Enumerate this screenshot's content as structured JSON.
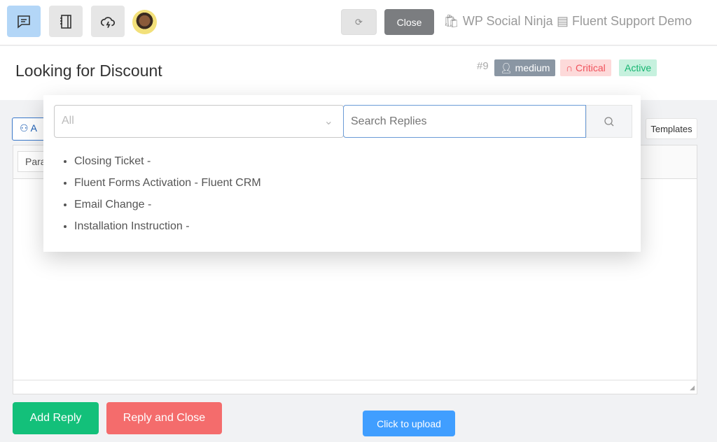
{
  "topbar": {
    "close_label": "Close",
    "crumbs": [
      "WP Social Ninja",
      "Fluent Support Demo"
    ]
  },
  "ticket": {
    "title": "Looking for Discount",
    "number": "#9",
    "badges": {
      "priority_label": "medium",
      "severity_label": "Critical",
      "status_label": "Active"
    }
  },
  "editor": {
    "ai_label": "A",
    "format_label": "Para",
    "templates_label": "Templates"
  },
  "saved_replies": {
    "category_value": "All",
    "search_placeholder": "Search Replies",
    "items": [
      "Closing Ticket -",
      "Fluent Forms Activation - Fluent CRM",
      "Email Change -",
      "Installation Instruction -"
    ]
  },
  "actions": {
    "add_reply": "Add Reply",
    "reply_close": "Reply and Close",
    "upload": "Click to upload"
  },
  "colors": {
    "green": "#13c07a",
    "red": "#f46c6c",
    "blue": "#409eff"
  }
}
